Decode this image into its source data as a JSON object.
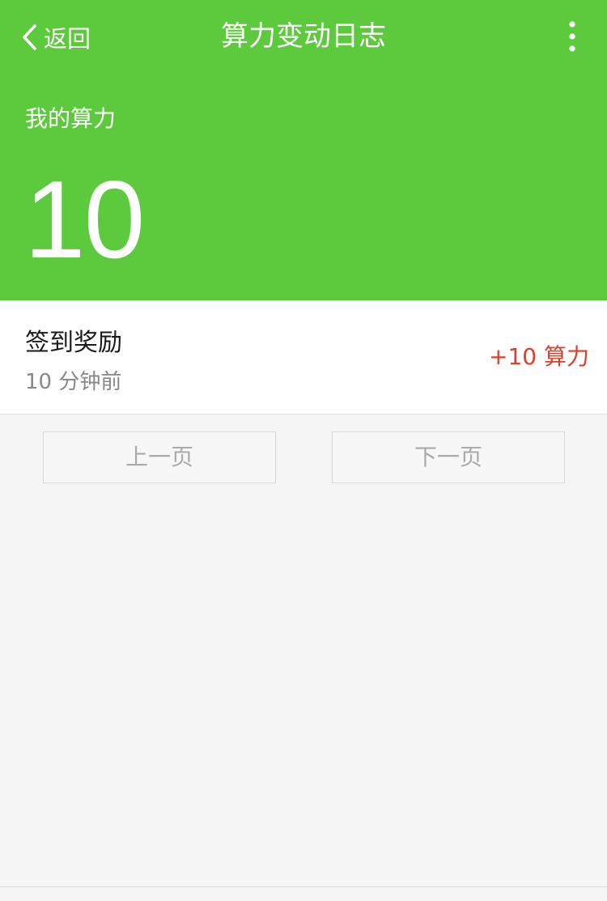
{
  "nav": {
    "back_label": "返回",
    "title": "算力变动日志",
    "back_icon": "chevron-left-icon",
    "more_icon": "more-vertical-icon"
  },
  "summary": {
    "label": "我的算力",
    "value": "10"
  },
  "records": [
    {
      "title": "签到奖励",
      "time": "10 分钟前",
      "amount": "+10 算力"
    }
  ],
  "pager": {
    "prev_label": "上一页",
    "next_label": "下一页"
  },
  "colors": {
    "header_bg": "#5dca3e",
    "amount": "#d9412f",
    "page_bg": "#f5f5f5"
  }
}
